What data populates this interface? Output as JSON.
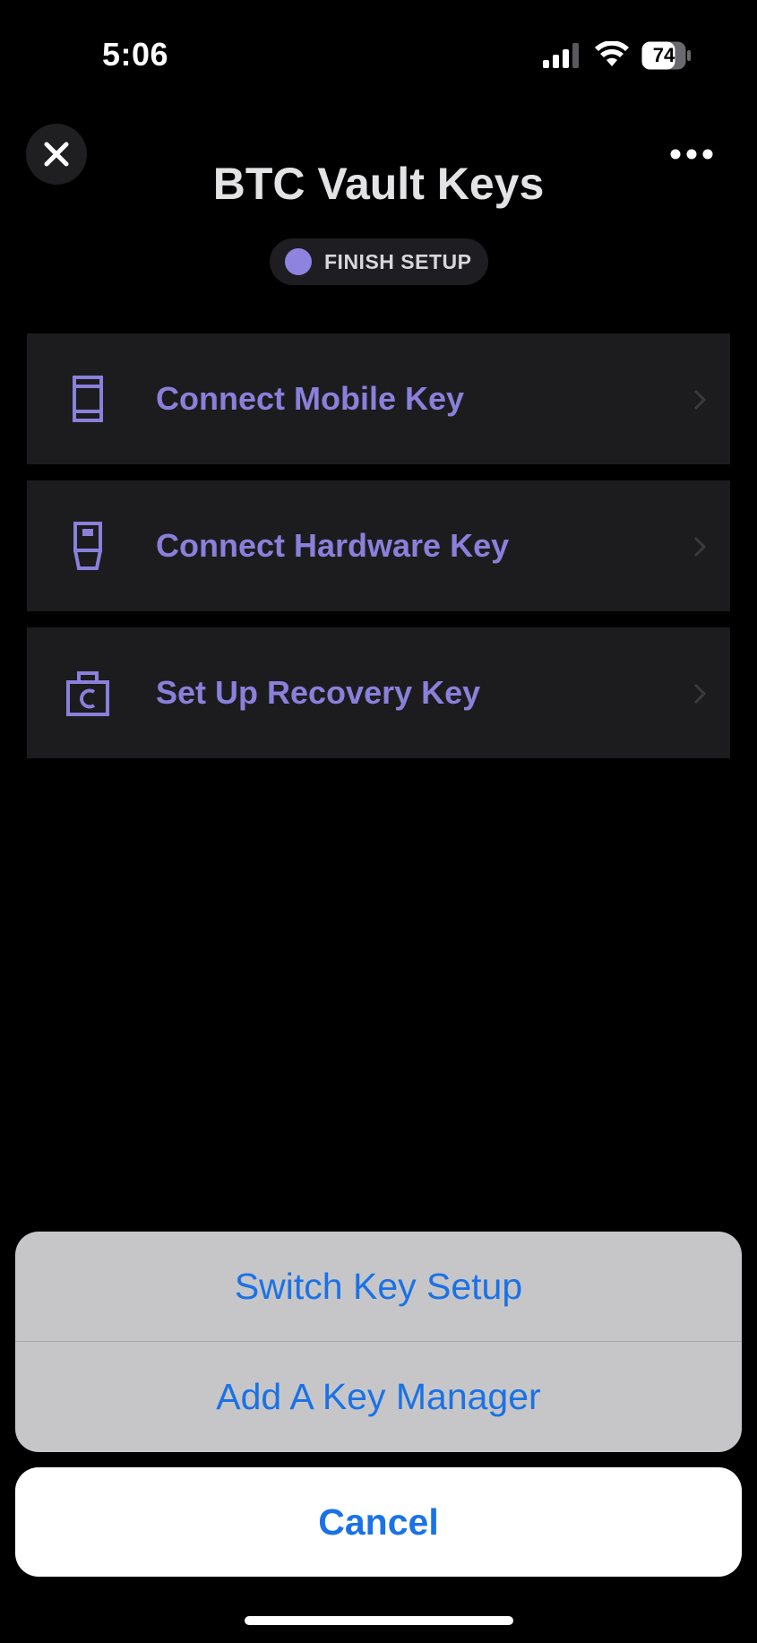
{
  "status_bar": {
    "time": "5:06",
    "battery": "74",
    "icons": [
      "signal-icon",
      "wifi-icon",
      "battery-icon"
    ]
  },
  "header": {
    "title": "BTC Vault Keys",
    "close_icon": "close-icon",
    "more_icon": "more-icon",
    "status_badge": "FINISH SETUP",
    "status_color": "#8f83e0"
  },
  "keys": [
    {
      "label": "Connect Mobile Key",
      "icon": "mobile-key-icon"
    },
    {
      "label": "Connect Hardware Key",
      "icon": "hardware-key-icon"
    },
    {
      "label": "Set Up Recovery Key",
      "icon": "recovery-key-icon"
    }
  ],
  "action_sheet": {
    "items": [
      {
        "label": "Switch Key Setup"
      },
      {
        "label": "Add A Key Manager"
      }
    ],
    "cancel_label": "Cancel"
  },
  "colors": {
    "accent": "#8a80db",
    "action_blue": "#1a72e6",
    "background": "#000000",
    "row_background": "#1c1c1e"
  }
}
